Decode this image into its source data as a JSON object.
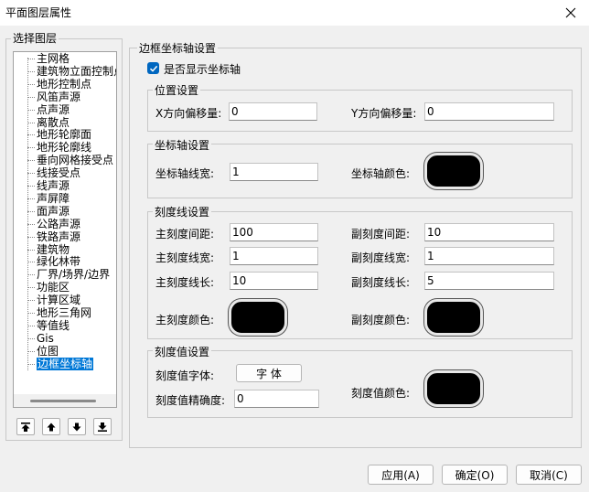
{
  "window": {
    "title": "平面图层属性"
  },
  "layers": {
    "group_label": "选择图层",
    "items": [
      "主网格",
      "建筑物立面控制点",
      "地形控制点",
      "风笛声源",
      "点声源",
      "离散点",
      "地形轮廓面",
      "地形轮廓线",
      "垂向网格接受点",
      "线接受点",
      "线声源",
      "声屏障",
      "面声源",
      "公路声源",
      "铁路声源",
      "建筑物",
      "绿化林带",
      "厂界/场界/边界",
      "功能区",
      "计算区域",
      "地形三角网",
      "等值线",
      "Gis",
      "位图",
      "边框坐标轴"
    ],
    "selected_index": 24
  },
  "settings": {
    "group_label": "边框坐标轴设置",
    "show_axis_label": "是否显示坐标轴",
    "show_axis_checked": true
  },
  "position": {
    "group_label": "位置设置",
    "x_offset_label": "X方向偏移量:",
    "x_offset_value": "0",
    "y_offset_label": "Y方向偏移量:",
    "y_offset_value": "0"
  },
  "axis": {
    "group_label": "坐标轴设置",
    "width_label": "坐标轴线宽:",
    "width_value": "1",
    "color_label": "坐标轴颜色:"
  },
  "ticks": {
    "group_label": "刻度线设置",
    "major_spacing_label": "主刻度间距:",
    "major_spacing_value": "100",
    "minor_spacing_label": "副刻度间距:",
    "minor_spacing_value": "10",
    "major_width_label": "主刻度线宽:",
    "major_width_value": "1",
    "minor_width_label": "副刻度线宽:",
    "minor_width_value": "1",
    "major_length_label": "主刻度线长:",
    "major_length_value": "10",
    "minor_length_label": "副刻度线长:",
    "minor_length_value": "5",
    "major_color_label": "主刻度颜色:",
    "minor_color_label": "副刻度颜色:"
  },
  "tickvalues": {
    "group_label": "刻度值设置",
    "font_label": "刻度值字体:",
    "font_button": "字 体",
    "precision_label": "刻度值精确度:",
    "precision_value": "0",
    "color_label": "刻度值颜色:"
  },
  "footer": {
    "apply": "应用(A)",
    "ok": "确定(O)",
    "cancel": "取消(C)"
  },
  "colors": {
    "accent": "#0067c0",
    "selection": "#0078d7",
    "swatch": "#000000"
  }
}
